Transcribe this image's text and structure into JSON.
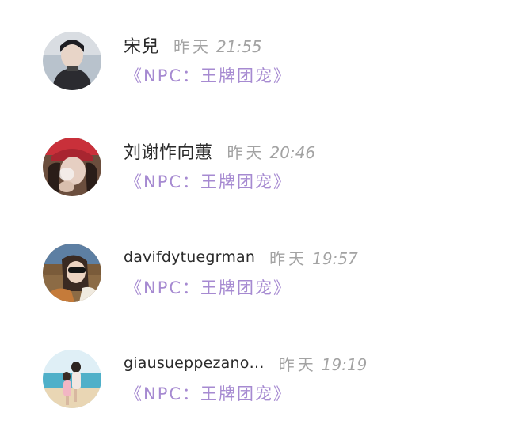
{
  "feed": {
    "items": [
      {
        "name": "宋兒",
        "date": "昨天",
        "clock": "21:55",
        "source": "《NPC：王牌团宠》",
        "avatar_icon": "user-avatar-photo"
      },
      {
        "name": "刘谢怍向蕙",
        "date": "昨天",
        "clock": "20:46",
        "source": "《NPC：王牌团宠》",
        "avatar_icon": "user-avatar-photo"
      },
      {
        "name": "davifdytuegrman",
        "date": "昨天",
        "clock": "19:57",
        "source": "《NPC：王牌团宠》",
        "avatar_icon": "user-avatar-photo"
      },
      {
        "name": "giausueppezano…",
        "date": "昨天",
        "clock": "19:19",
        "source": "《NPC：王牌团宠》",
        "avatar_icon": "user-avatar-photo"
      }
    ]
  },
  "colors": {
    "name": "#2a2a2a",
    "time": "#a3a3a3",
    "source": "#a68ad1",
    "divider": "#f0f0f0"
  }
}
